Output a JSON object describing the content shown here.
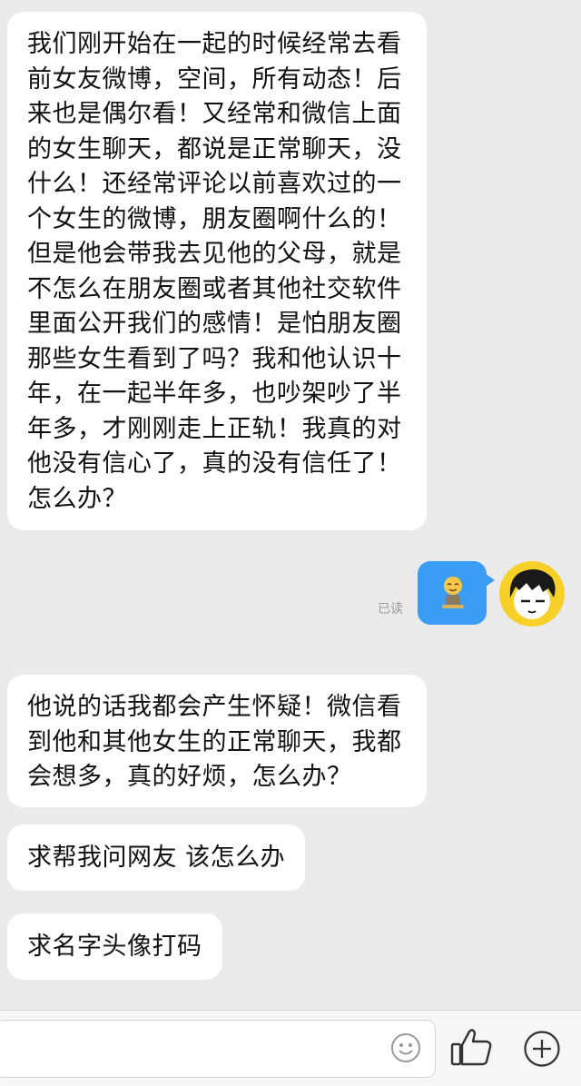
{
  "messages": [
    {
      "direction": "incoming",
      "text": "我们刚开始在一起的时候经常去看前女友微博，空间，所有动态！后来也是偶尔看！又经常和微信上面的女生聊天，都说是正常聊天，没什么！还经常评论以前喜欢过的一个女生的微博，朋友圈啊什么的！但是他会带我去见他的父母，就是不怎么在朋友圈或者其他社交软件里面公开我们的感情！是怕朋友圈那些女生看到了吗？我和他认识十年，在一起半年多，也吵架吵了半年多，才刚刚走上正轨！我真的对他没有信心了，真的没有信任了！怎么办？"
    },
    {
      "direction": "outgoing",
      "type": "sticker",
      "icon": "sticker-icon",
      "status": "已读"
    },
    {
      "direction": "incoming",
      "text": "他说的话我都会产生怀疑！微信看到他和其他女生的正常聊天，我都会想多，真的好烦，怎么办？"
    },
    {
      "direction": "incoming",
      "text": "求帮我问网友 该怎么办"
    },
    {
      "direction": "incoming",
      "text": "求名字头像打码"
    }
  ],
  "input_bar": {
    "icons": [
      "emoji-icon",
      "thumbs-up-icon",
      "plus-icon"
    ]
  },
  "colors": {
    "background": "#ebebeb",
    "incoming_bubble": "#ffffff",
    "outgoing_bubble": "#3b9cf4",
    "avatar_bg": "#f7d02a"
  }
}
